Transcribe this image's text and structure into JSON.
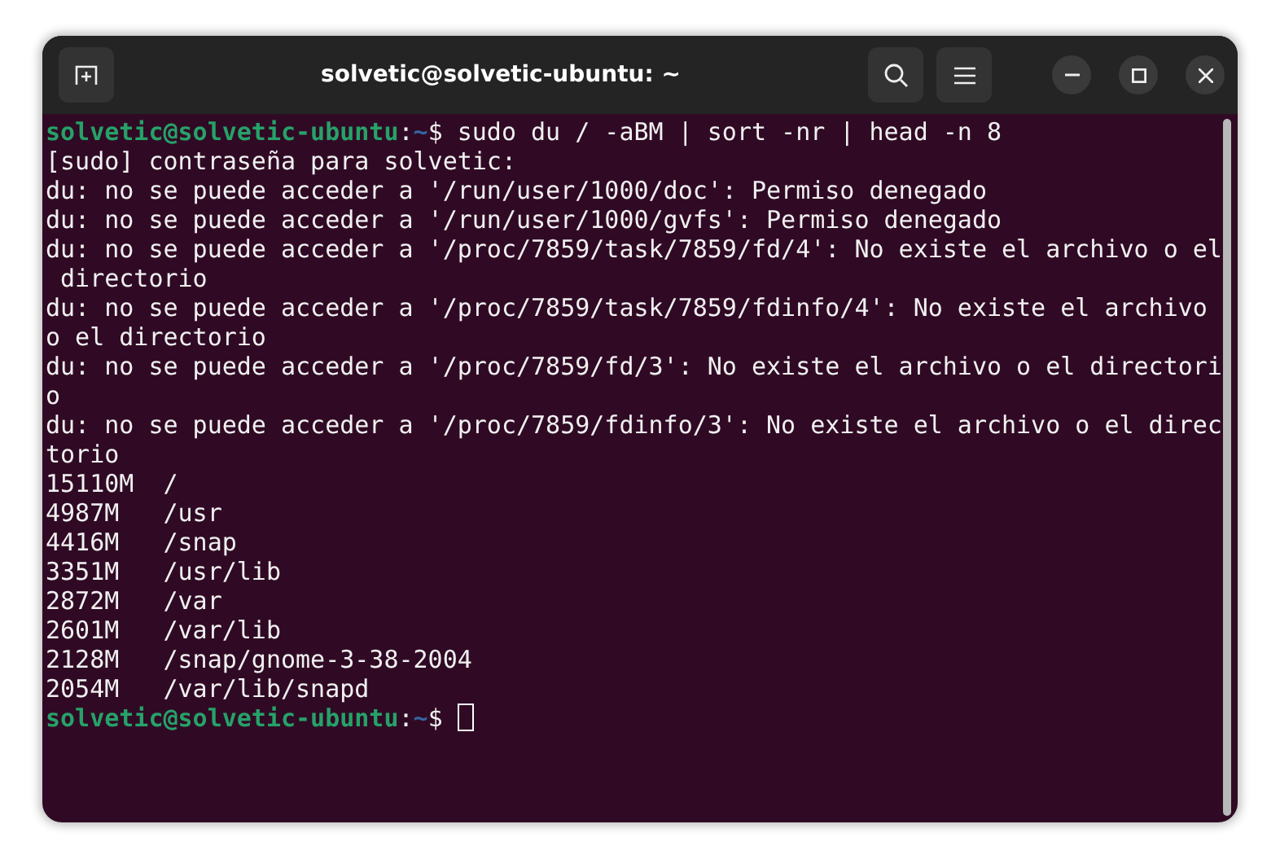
{
  "window": {
    "title": "solvetic@solvetic-ubuntu: ~"
  },
  "terminal": {
    "lines": [
      {
        "kind": "prompt",
        "user": "solvetic@solvetic-ubuntu",
        "separator": ":",
        "path": "~",
        "symbol": "$",
        "command": "sudo du / -aBM | sort -nr | head -n 8"
      },
      {
        "kind": "output",
        "text": "[sudo] contraseña para solvetic:"
      },
      {
        "kind": "output",
        "text": "du: no se puede acceder a '/run/user/1000/doc': Permiso denegado"
      },
      {
        "kind": "output",
        "text": "du: no se puede acceder a '/run/user/1000/gvfs': Permiso denegado"
      },
      {
        "kind": "output",
        "text": "du: no se puede acceder a '/proc/7859/task/7859/fd/4': No existe el archivo o el"
      },
      {
        "kind": "output",
        "text": " directorio"
      },
      {
        "kind": "output",
        "text": "du: no se puede acceder a '/proc/7859/task/7859/fdinfo/4': No existe el archivo"
      },
      {
        "kind": "output",
        "text": "o el directorio"
      },
      {
        "kind": "output",
        "text": "du: no se puede acceder a '/proc/7859/fd/3': No existe el archivo o el directori"
      },
      {
        "kind": "output",
        "text": "o"
      },
      {
        "kind": "output",
        "text": "du: no se puede acceder a '/proc/7859/fdinfo/3': No existe el archivo o el direc"
      },
      {
        "kind": "output",
        "text": "torio"
      },
      {
        "kind": "output",
        "text": "15110M  /"
      },
      {
        "kind": "output",
        "text": "4987M   /usr"
      },
      {
        "kind": "output",
        "text": "4416M   /snap"
      },
      {
        "kind": "output",
        "text": "3351M   /usr/lib"
      },
      {
        "kind": "output",
        "text": "2872M   /var"
      },
      {
        "kind": "output",
        "text": "2601M   /var/lib"
      },
      {
        "kind": "output",
        "text": "2128M   /snap/gnome-3-38-2004"
      },
      {
        "kind": "output",
        "text": "2054M   /var/lib/snapd"
      },
      {
        "kind": "prompt",
        "user": "solvetic@solvetic-ubuntu",
        "separator": ":",
        "path": "~",
        "symbol": "$",
        "cursor": true
      }
    ]
  }
}
